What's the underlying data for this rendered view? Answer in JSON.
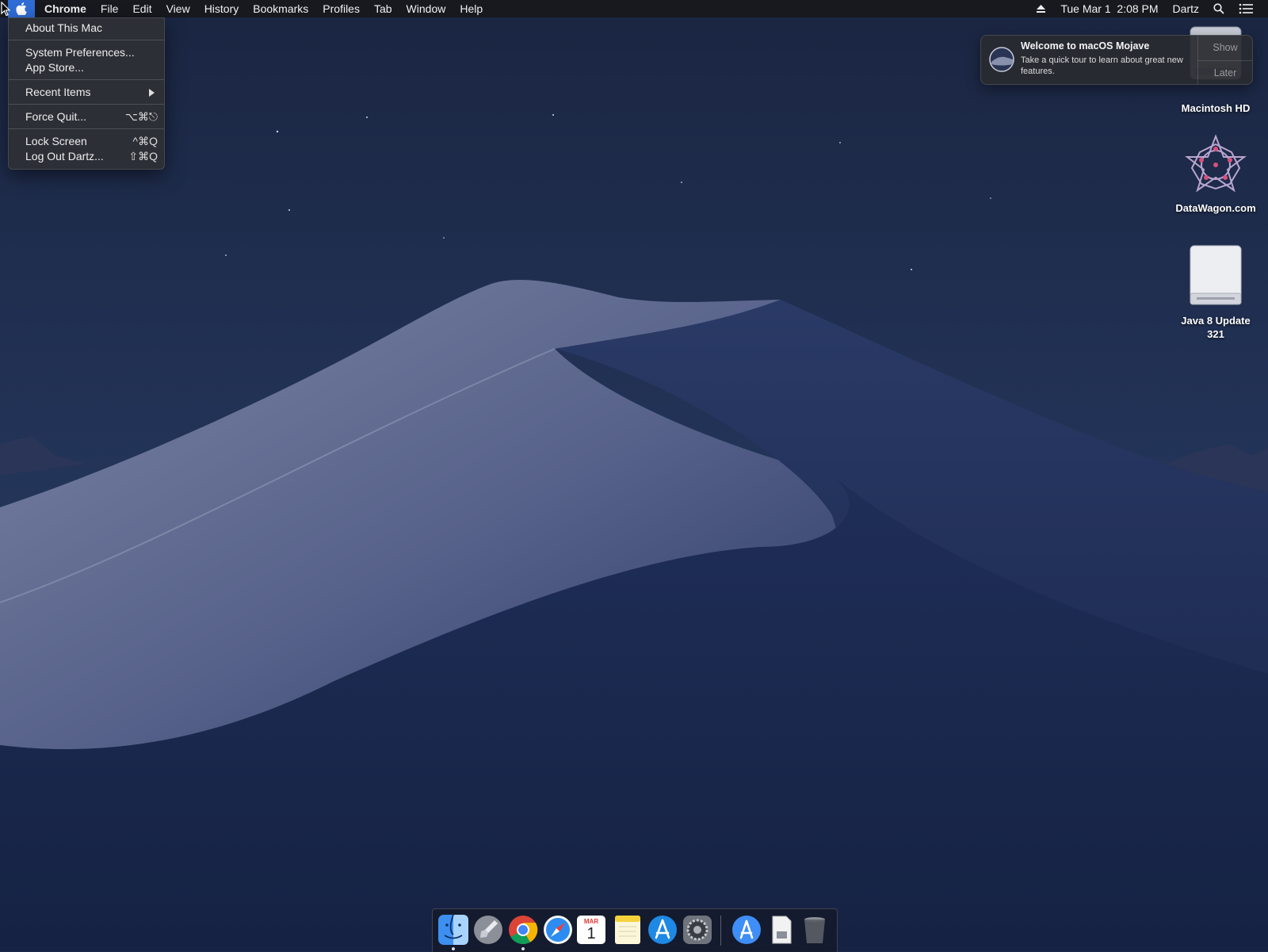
{
  "menubar": {
    "app_name": "Chrome",
    "menus": [
      "File",
      "Edit",
      "View",
      "History",
      "Bookmarks",
      "Profiles",
      "Tab",
      "Window",
      "Help"
    ],
    "datetime": "Tue Mar 1  2:08 PM",
    "user": "Dartz",
    "icons": [
      "apple-icon",
      "eject-icon",
      "spotlight-icon",
      "notification-center-icon"
    ]
  },
  "apple_menu": {
    "about": "About This Mac",
    "system_prefs": "System Preferences...",
    "app_store": "App Store...",
    "recent_items": "Recent Items",
    "force_quit": {
      "label": "Force Quit...",
      "shortcut": "⌥⌘⎋"
    },
    "lock_screen": {
      "label": "Lock Screen",
      "shortcut": "^⌘Q"
    },
    "log_out": {
      "label": "Log Out Dartz...",
      "shortcut": "⇧⌘Q"
    }
  },
  "notification": {
    "title": "Welcome to macOS Mojave",
    "body": "Take a quick tour to learn about great new features.",
    "show_label": "Show",
    "later_label": "Later"
  },
  "desktop_icons": {
    "macintosh_hd": "Macintosh HD",
    "datawagon": "DataWagon.com",
    "java_line1": "Java 8 Update",
    "java_line2": "321"
  },
  "dock": {
    "items": [
      "Finder",
      "Launchpad",
      "Google Chrome",
      "Safari",
      "Calendar",
      "Notes",
      "App Store",
      "System Preferences",
      "Applications",
      "Documents",
      "Trash"
    ],
    "calendar_month": "MAR",
    "calendar_day": "1"
  },
  "colors": {
    "accent": "#2f6cd6",
    "sky": "#1b2846",
    "menubar": "#18181c"
  }
}
